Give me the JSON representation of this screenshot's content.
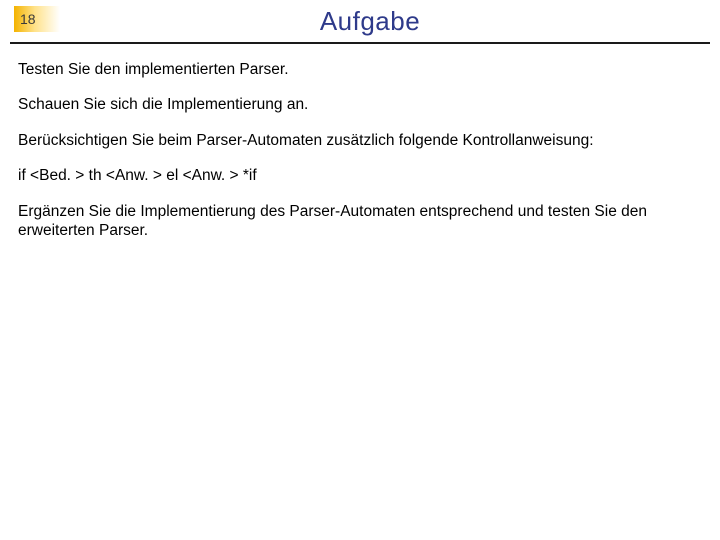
{
  "header": {
    "page_number": "18",
    "title": "Aufgabe"
  },
  "body": {
    "p1": "Testen Sie den implementierten Parser.",
    "p2": "Schauen Sie sich die Implementierung an.",
    "p3": "Berücksichtigen Sie beim Parser-Automaten zusätzlich folgende Kontrollanweisung:",
    "p4": "if <Bed. > th <Anw. > el <Anw. > *if",
    "p5": "Ergänzen Sie die Implementierung des Parser-Automaten entsprechend und testen Sie den erweiterten Parser."
  }
}
